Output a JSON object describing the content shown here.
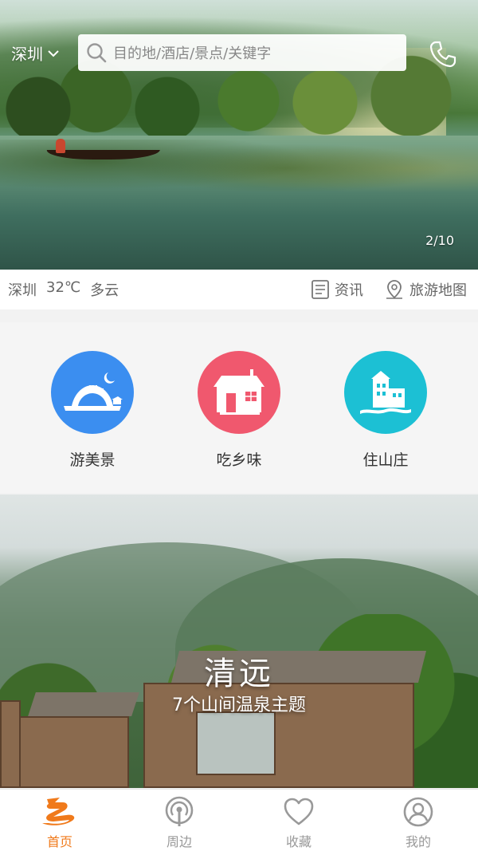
{
  "header": {
    "city": "深圳",
    "search_placeholder": "目的地/酒店/景点/关键字",
    "pager": "2/10"
  },
  "infobar": {
    "city": "深圳",
    "temperature": "32℃",
    "condition": "多云",
    "news_label": "资讯",
    "map_label": "旅游地图"
  },
  "categories": [
    {
      "label": "游美景",
      "color": "#3b8ef0",
      "icon": "bridge-moon-icon"
    },
    {
      "label": "吃乡味",
      "color": "#f0586e",
      "icon": "house-icon"
    },
    {
      "label": "住山庄",
      "color": "#1cc0d4",
      "icon": "villa-icon"
    }
  ],
  "feature": {
    "title": "清远",
    "subtitle": "7个山间温泉主题"
  },
  "tabs": [
    {
      "label": "首页",
      "icon": "home-logo-icon",
      "active": true
    },
    {
      "label": "周边",
      "icon": "nearby-icon",
      "active": false
    },
    {
      "label": "收藏",
      "icon": "heart-icon",
      "active": false
    },
    {
      "label": "我的",
      "icon": "user-icon",
      "active": false
    }
  ],
  "colors": {
    "accent": "#f07a1b",
    "tab_inactive": "#999999"
  }
}
